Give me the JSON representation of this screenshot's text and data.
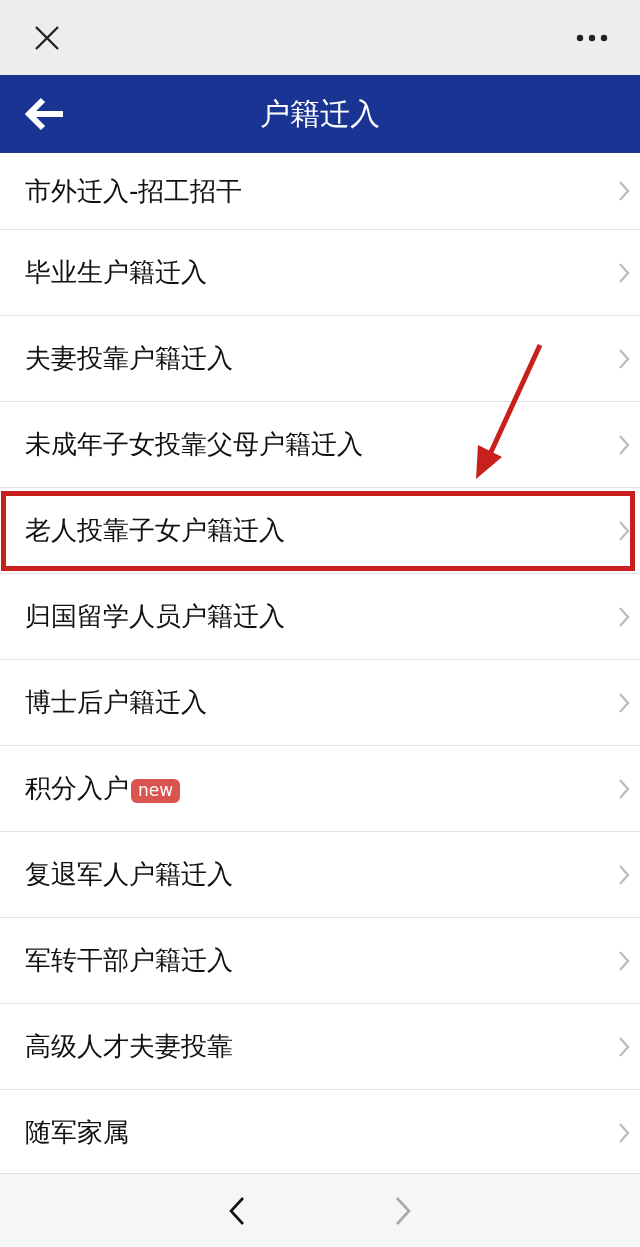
{
  "header": {
    "title": "户籍迁入"
  },
  "items": [
    {
      "label": "市外迁入-招工招干",
      "highlighted": false
    },
    {
      "label": "毕业生户籍迁入",
      "highlighted": false
    },
    {
      "label": "夫妻投靠户籍迁入",
      "highlighted": false
    },
    {
      "label": "未成年子女投靠父母户籍迁入",
      "highlighted": false
    },
    {
      "label": "老人投靠子女户籍迁入",
      "highlighted": true
    },
    {
      "label": "归国留学人员户籍迁入",
      "highlighted": false
    },
    {
      "label": "博士后户籍迁入",
      "highlighted": false
    },
    {
      "label": "积分入户",
      "badge": "new",
      "highlighted": false
    },
    {
      "label": "复退军人户籍迁入",
      "highlighted": false
    },
    {
      "label": "军转干部户籍迁入",
      "highlighted": false
    },
    {
      "label": "高级人才夫妻投靠",
      "highlighted": false
    },
    {
      "label": "随军家属",
      "highlighted": false
    }
  ],
  "toolbar": {
    "back_disabled": false,
    "forward_disabled": true
  }
}
